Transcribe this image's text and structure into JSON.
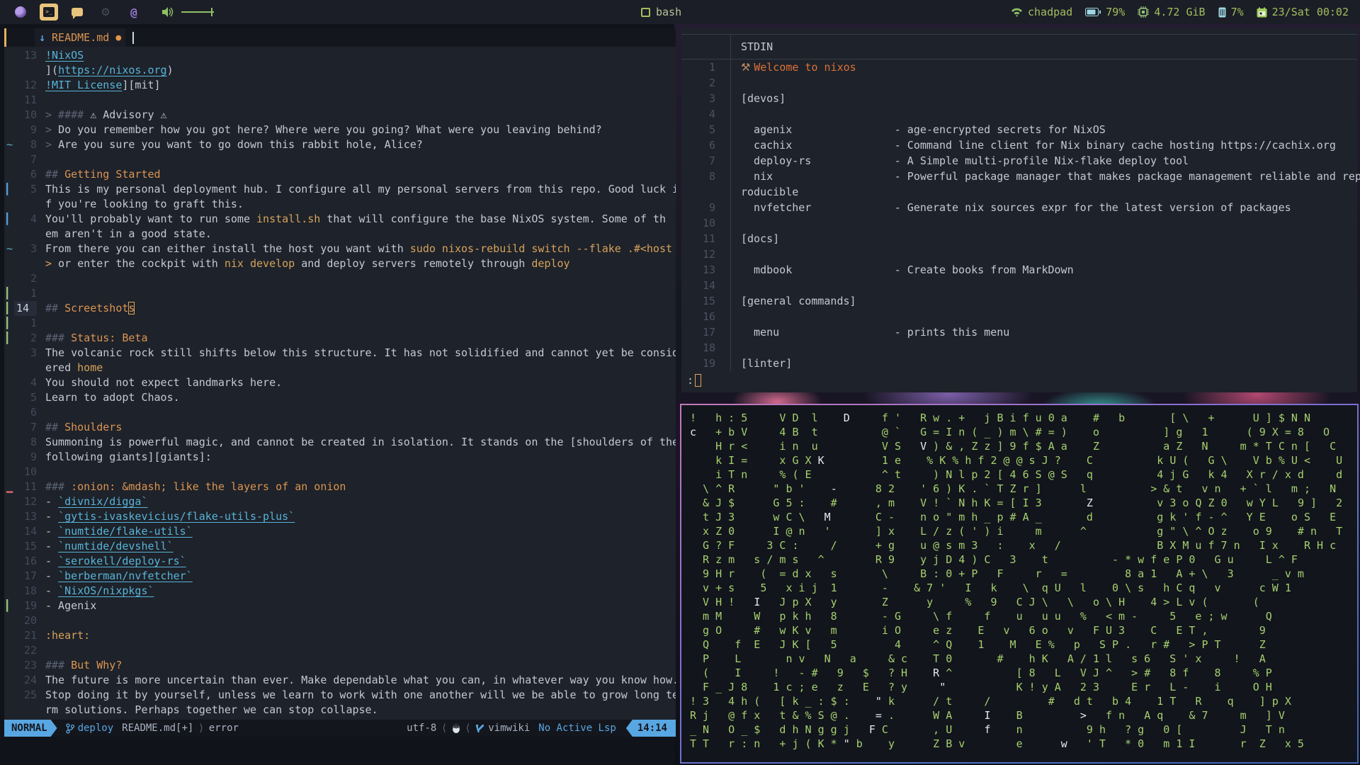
{
  "topbar": {
    "center_label": "bash",
    "right": {
      "hostname": "chadpad",
      "battery": "79%",
      "memory": "4.72 GiB",
      "cpu": "7%",
      "clock": "23/Sat 00:02"
    }
  },
  "editor": {
    "tab": {
      "title": "README.md",
      "icon": "↓",
      "modified_dot": "●"
    },
    "statusline": {
      "mode": "NORMAL",
      "branch": "deploy",
      "file": "README.md[+]",
      "sep": "⟩",
      "diagnostic": "error",
      "encoding": "utf-8",
      "lsep": "⟨",
      "filetype": "vimwiki",
      "lsp": "No Active Lsp",
      "time": "14:14"
    },
    "lines": [
      {
        "g": "13",
        "s": "",
        "t": [
          [
            "l",
            "!NixOS"
          ]
        ]
      },
      {
        "g": "",
        "s": "",
        "t": [
          [
            "n",
            "]("
          ],
          [
            "l",
            "https://nixos.org"
          ],
          [
            "n",
            ")"
          ]
        ]
      },
      {
        "g": "12",
        "s": "",
        "t": [
          [
            "l",
            "!MIT License"
          ],
          [
            "n",
            "][mit]"
          ]
        ]
      },
      {
        "g": "11",
        "s": "",
        "t": []
      },
      {
        "g": "10",
        "s": "",
        "t": [
          [
            "d",
            "> #### "
          ],
          [
            "n",
            "⚠ Advisory ⚠"
          ]
        ]
      },
      {
        "g": "9",
        "s": "",
        "t": [
          [
            "d",
            "> "
          ],
          [
            "n",
            "Do you remember how you got here? Where were you going? What were you leaving behind?"
          ]
        ]
      },
      {
        "g": "8",
        "s": "tilde",
        "t": [
          [
            "d",
            "> "
          ],
          [
            "n",
            "Are you sure you want to go down this rabbit hole, Alice?"
          ]
        ]
      },
      {
        "g": "7",
        "s": "",
        "t": []
      },
      {
        "g": "6",
        "s": "",
        "t": [
          [
            "d",
            "## "
          ],
          [
            "h",
            "Getting Started"
          ]
        ]
      },
      {
        "g": "5",
        "s": "blue",
        "t": [
          [
            "n",
            "This is my personal deployment hub. I configure all my personal servers from this repo. Good luck i"
          ]
        ]
      },
      {
        "g": "",
        "s": "",
        "t": [
          [
            "n",
            "f you're looking to graft this."
          ]
        ]
      },
      {
        "g": "4",
        "s": "blue",
        "t": [
          [
            "n",
            "You'll probably want to run some "
          ],
          [
            "c",
            "install.sh"
          ],
          [
            "n",
            " that will configure the base NixOS system. Some of th"
          ]
        ]
      },
      {
        "g": "",
        "s": "",
        "t": [
          [
            "n",
            "em aren't in a good state."
          ]
        ]
      },
      {
        "g": "3",
        "s": "tilde",
        "t": [
          [
            "n",
            "From there you can either install the host you want with "
          ],
          [
            "c",
            "sudo nixos-rebuild switch --flake .#<host"
          ]
        ]
      },
      {
        "g": "",
        "s": "",
        "t": [
          [
            "c",
            ">"
          ],
          [
            "n",
            " or enter the cockpit with "
          ],
          [
            "c",
            "nix develop"
          ],
          [
            "n",
            " and deploy servers remotely through "
          ],
          [
            "c",
            "deploy"
          ]
        ]
      },
      {
        "g": "2",
        "s": "",
        "t": []
      },
      {
        "g": "1",
        "s": "green",
        "t": []
      },
      {
        "g": "14",
        "cur": true,
        "s": "green",
        "t": [
          [
            "d",
            "## "
          ],
          [
            "h",
            "Screetshot"
          ],
          [
            "k",
            "s"
          ]
        ]
      },
      {
        "g": "1",
        "s": "green",
        "t": []
      },
      {
        "g": "2",
        "s": "green",
        "t": [
          [
            "d",
            "### "
          ],
          [
            "h",
            "Status: Beta"
          ]
        ]
      },
      {
        "g": "3",
        "s": "",
        "t": [
          [
            "n",
            "The volcanic rock still shifts below this structure. It has not solidified and cannot yet be consid"
          ]
        ]
      },
      {
        "g": "",
        "s": "",
        "t": [
          [
            "n",
            "ered "
          ],
          [
            "c",
            "home"
          ]
        ]
      },
      {
        "g": "4",
        "s": "",
        "t": [
          [
            "n",
            "You should not expect landmarks here."
          ]
        ]
      },
      {
        "g": "5",
        "s": "",
        "t": [
          [
            "n",
            "Learn to adopt Chaos."
          ]
        ]
      },
      {
        "g": "6",
        "s": "",
        "t": []
      },
      {
        "g": "7",
        "s": "",
        "t": [
          [
            "d",
            "## "
          ],
          [
            "h",
            "Shoulders"
          ]
        ]
      },
      {
        "g": "8",
        "s": "",
        "t": [
          [
            "n",
            "Summoning is powerful magic, and cannot be created in isolation. It stands on the [shoulders of the"
          ]
        ]
      },
      {
        "g": "9",
        "s": "",
        "t": [
          [
            "n",
            "following giants][giants]:"
          ]
        ]
      },
      {
        "g": "10",
        "s": "",
        "t": []
      },
      {
        "g": "11",
        "s": "red",
        "t": [
          [
            "d",
            "### "
          ],
          [
            "h",
            ":onion: &mdash; like the layers of an onion"
          ]
        ]
      },
      {
        "g": "12",
        "s": "",
        "t": [
          [
            "n",
            "- "
          ],
          [
            "l",
            "`divnix/digga`"
          ]
        ]
      },
      {
        "g": "13",
        "s": "",
        "t": [
          [
            "n",
            "- "
          ],
          [
            "l",
            "`gytis-ivaskevicius/flake-utils-plus`"
          ]
        ]
      },
      {
        "g": "14",
        "s": "",
        "t": [
          [
            "n",
            "- "
          ],
          [
            "l",
            "`numtide/flake-utils`"
          ]
        ]
      },
      {
        "g": "15",
        "s": "",
        "t": [
          [
            "n",
            "- "
          ],
          [
            "l",
            "`numtide/devshell`"
          ]
        ]
      },
      {
        "g": "16",
        "s": "",
        "t": [
          [
            "n",
            "- "
          ],
          [
            "l",
            "`serokell/deploy-rs`"
          ]
        ]
      },
      {
        "g": "17",
        "s": "",
        "t": [
          [
            "n",
            "- "
          ],
          [
            "l",
            "`berberman/nvfetcher`"
          ]
        ]
      },
      {
        "g": "18",
        "s": "",
        "t": [
          [
            "n",
            "- "
          ],
          [
            "l",
            "`NixOS/nixpkgs`"
          ]
        ]
      },
      {
        "g": "19",
        "s": "green",
        "t": [
          [
            "n",
            "- Agenix"
          ]
        ]
      },
      {
        "g": "20",
        "s": "",
        "t": []
      },
      {
        "g": "21",
        "s": "",
        "t": [
          [
            "c",
            ":heart:"
          ]
        ]
      },
      {
        "g": "22",
        "s": "",
        "t": []
      },
      {
        "g": "23",
        "s": "",
        "t": [
          [
            "d",
            "### "
          ],
          [
            "h",
            "But Why?"
          ]
        ]
      },
      {
        "g": "24",
        "s": "",
        "t": [
          [
            "n",
            "The future is more uncertain than ever. Make dependable what you can, in whatever way you know how."
          ]
        ]
      },
      {
        "g": "25",
        "s": "",
        "t": [
          [
            "n",
            "Stop doing it by yourself, unless we learn to work with one another will we be able to grow long te"
          ]
        ]
      },
      {
        "g": "",
        "s": "",
        "t": [
          [
            "n",
            "rm solutions. Perhaps together we can stop collapse."
          ]
        ]
      }
    ]
  },
  "pager": {
    "title": "STDIN",
    "prompt": ":",
    "lines": [
      {
        "n": "1",
        "t": [
          [
            "hm",
            "⚒ "
          ],
          [
            "a",
            "Welcome to nixos"
          ]
        ]
      },
      {
        "n": "2",
        "t": []
      },
      {
        "n": "3",
        "t": [
          [
            "n",
            "[devos]"
          ]
        ]
      },
      {
        "n": "4",
        "t": []
      },
      {
        "n": "5",
        "t": [
          [
            "n",
            "  agenix                - age-encrypted secrets for NixOS"
          ]
        ]
      },
      {
        "n": "6",
        "t": [
          [
            "n",
            "  cachix                - Command line client for Nix binary cache hosting https://cachix.org"
          ]
        ]
      },
      {
        "n": "7",
        "t": [
          [
            "n",
            "  deploy-rs             - A Simple multi-profile Nix-flake deploy tool"
          ]
        ]
      },
      {
        "n": "8",
        "t": [
          [
            "n",
            "  nix                   - Powerful package manager that makes package management reliable and rep"
          ]
        ]
      },
      {
        "n": "",
        "t": [
          [
            "n",
            "roducible"
          ]
        ]
      },
      {
        "n": "9",
        "t": [
          [
            "n",
            "  nvfetcher             - Generate nix sources expr for the latest version of packages"
          ]
        ]
      },
      {
        "n": "10",
        "t": []
      },
      {
        "n": "11",
        "t": [
          [
            "n",
            "[docs]"
          ]
        ]
      },
      {
        "n": "12",
        "t": []
      },
      {
        "n": "13",
        "t": [
          [
            "n",
            "  mdbook                - Create books from MarkDown"
          ]
        ]
      },
      {
        "n": "14",
        "t": []
      },
      {
        "n": "15",
        "t": [
          [
            "n",
            "[general commands]"
          ]
        ]
      },
      {
        "n": "16",
        "t": []
      },
      {
        "n": "17",
        "t": [
          [
            "n",
            "  menu                  - prints this menu"
          ]
        ]
      },
      {
        "n": "18",
        "t": []
      },
      {
        "n": "19",
        "t": [
          [
            "n",
            "[linter]"
          ]
        ]
      }
    ]
  },
  "matrix": {
    "rows": [
      "!   h : 5     V D  l    D     f '   R w . +   j B i f u 0 a    #   b       [ \\   +      U ] $ N N",
      "c   + b V     4 B  t          @ `   G = I n ( _ ) m \\ # = )    o          ] g   1      ( 9 X = 8   O",
      "    H r <     i n  u          V S   V ) & , Z z ] 9 f $ A a    Z          a Z   N     m * T C n [   C",
      "    k I =     x G X K         1 e    % K % h f 2 @ @ s J ?    C          k U (   G \\    V b % U <    U",
      "    i T n     % ( E           ^ t     ) N l p 2 [ 4 6 S @ S   q          4 j G   k 4   X r / x d     d",
      "  \\ ^ R      \" b '    -      8 2    ' 6 ) K . ` T Z r ]      l          > & t   v n   + ` l   m ;   N",
      "  & J $      G 5 :    #      , m    V ! ` N h K = [ I 3       Z          v 3 o Q Z 0   w Y L   9 ]   2",
      "  t J 3      w C \\   M       C -    n o \" m h _ p # A _       d          g k ' f - ^   Y E    o S   E",
      "  x Z 0      I @ n   '       ] x    L / z ( ' ) i     m      ^           g \" \\ ^ O z    o 9    # n   T",
      "  G ? F     3 C :     /      + g    u @ s m 3   :    x   /               B X M u f 7 n   I x    R H c",
      "  R z m   s / m s   ^        R 9    y j D 4 ) C   3    t          - * w f e P 0   G u     L ^ F",
      "  9 H r    (  = d x   s       \\     B : 0 + P   F     r   =         8 a 1   A + \\   3      _ v m",
      "  v + s    5   x i j  1       -    & 7 '   I   k    \\  q U   l    0 \\ s   h C q   v      c W 1",
      "  V H !   I   J p X   y       Z      y     %   9   C J \\   \\   o \\ H    4 > L v (       (",
      "  m M     W   p k h   8       - G     \\ f     f    u   u u   %   < m -     5   e ; w      Q",
      "  g O     #   w K v   m       i O     e z    E   v   6 o   v   F U 3    C   E T ,        9",
      "  Q    f  E   J K [   5         4     ^ Q    1    M   E %   p   S P .   r #   > P T      Z",
      "  P    L       n v   N   a     & c    T 0       #    h K   A / 1 l   s 6   S ' x     !   A",
      "  (    I     !   - #   9   $   ? H    R ^          [ 8   L   V J ^   > #   8 f    8     % P",
      "  F _ J 8    1 c ; e   z   E   ? y     \"           K ! y A   2 3     E r   L -    i     O H",
      "! 3   4 h (   [ k _ : $ :    \" k      / t     /         #   d t   b 4    1 T   R    q    ] p X",
      "R j   @ f x   t & % S @ .    = .      W A     I    B         >   f n   A q    & 7     m   ] V",
      "_ N   O _ $   d h N g g j   F C       , U     f    n          9 h   ? g   0 [         J   T n",
      "T T   r : n   + j ( K * \" b    y      Z B v        e      w   ' T   * 0   m 1 I       r  Z   x 5"
    ],
    "white_cells": [
      [
        0,
        24
      ],
      [
        1,
        0
      ],
      [
        2,
        36
      ],
      [
        3,
        20
      ],
      [
        5,
        22
      ],
      [
        6,
        62
      ],
      [
        7,
        21
      ],
      [
        13,
        10
      ],
      [
        18,
        38
      ],
      [
        19,
        39
      ],
      [
        20,
        29
      ],
      [
        21,
        29
      ],
      [
        21,
        46
      ],
      [
        21,
        61
      ],
      [
        22,
        28
      ],
      [
        22,
        46
      ],
      [
        23,
        24
      ],
      [
        23,
        58
      ]
    ]
  }
}
